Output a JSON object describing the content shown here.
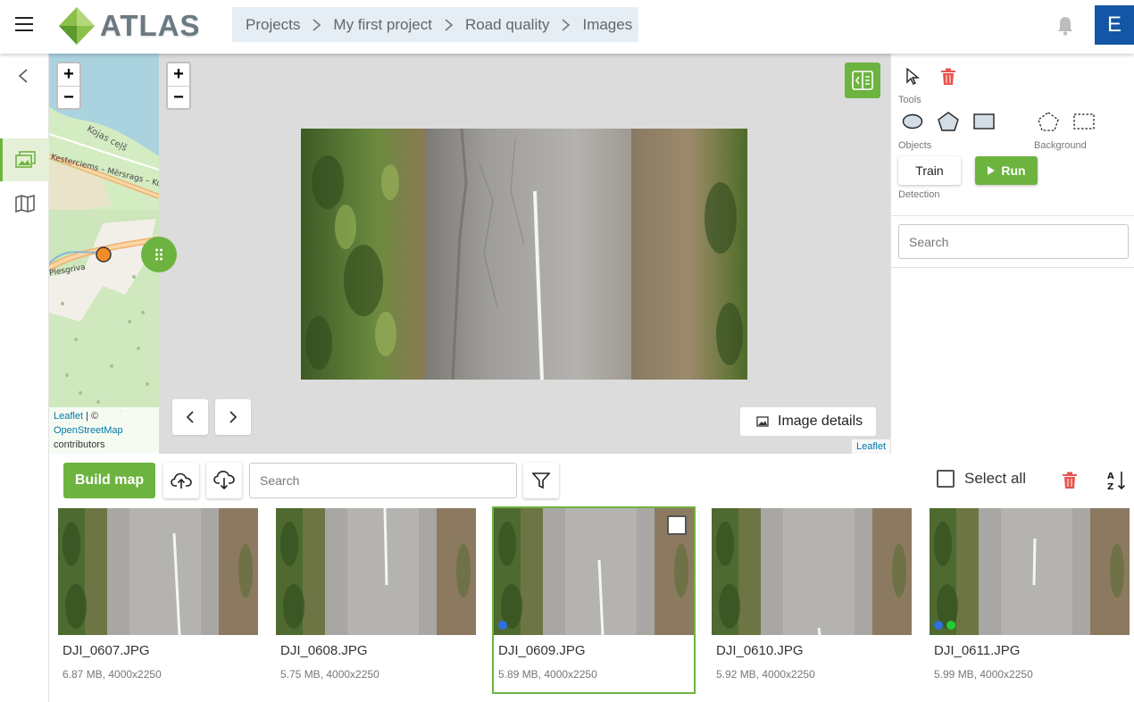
{
  "app": {
    "name": "ATLAS"
  },
  "breadcrumb": [
    "Projects",
    "My first project",
    "Road quality",
    "Images"
  ],
  "user": {
    "initial": "E"
  },
  "minimap": {
    "zoom_in": "+",
    "zoom_out": "−",
    "road_labels": [
      "Kojas ceļš",
      "Kesterciems – Mērsrags – Kolka",
      "Plesgriva"
    ],
    "attribution": {
      "leaflet": "Leaflet",
      "sep": " | ©",
      "osm": "OpenStreetMap",
      "rest": "contributors"
    }
  },
  "viewer": {
    "zoom_in": "+",
    "zoom_out": "−",
    "image_details_label": "Image details",
    "attribution": "Leaflet"
  },
  "panel": {
    "tools_label": "Tools",
    "objects_label": "Objects",
    "background_label": "Background",
    "detection_label": "Detection",
    "train_label": "Train",
    "run_label": "Run",
    "search_placeholder": "Search"
  },
  "toolbar": {
    "build_map_label": "Build map",
    "search_placeholder": "Search",
    "select_all_label": "Select all"
  },
  "images": [
    {
      "name": "DJI_0607.JPG",
      "meta": "6.87 MB, 4000x2250",
      "selected": false,
      "dots": []
    },
    {
      "name": "DJI_0608.JPG",
      "meta": "5.75 MB, 4000x2250",
      "selected": false,
      "dots": []
    },
    {
      "name": "DJI_0609.JPG",
      "meta": "5.89 MB, 4000x2250",
      "selected": true,
      "dots": [
        "#2f6fe0"
      ]
    },
    {
      "name": "DJI_0610.JPG",
      "meta": "5.92 MB, 4000x2250",
      "selected": false,
      "dots": []
    },
    {
      "name": "DJI_0611.JPG",
      "meta": "5.99 MB, 4000x2250",
      "selected": false,
      "dots": [
        "#2f6fe0",
        "#22cc33"
      ]
    }
  ],
  "colors": {
    "accent": "#6db33f",
    "avatar": "#1356a5",
    "danger": "#e8544f",
    "breadcrumb_bg": "#e5eef4"
  }
}
